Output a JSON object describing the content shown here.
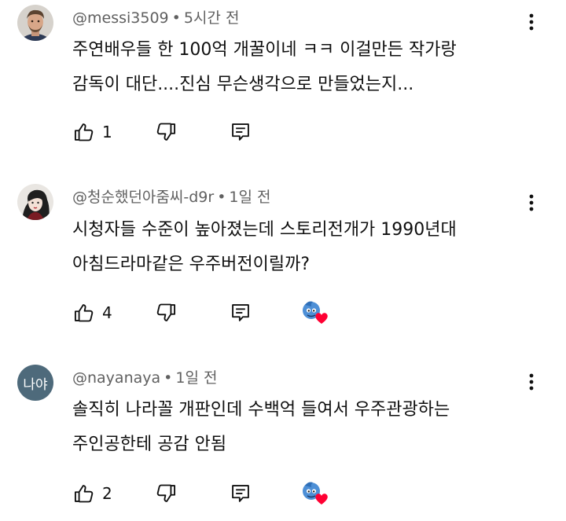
{
  "comments": [
    {
      "author": "@messi3509",
      "time": "5시간 전",
      "lines": [
        "주연배우들 한 100억 개꿀이네 ㅋㅋ 이걸만든 작가랑",
        "감독이 대단....진심 무슨생각으로 만들었는지..."
      ],
      "likes": "1",
      "avatar_icon": "profile-photo-icon",
      "creator_heart": false
    },
    {
      "author": "@청순했던아줌씨-d9r",
      "time": "1일 전",
      "lines": [
        "시청자들 수준이 높아졌는데  스토리전개가  1990년대",
        "아침드라마같은 우주버전이릴까?"
      ],
      "likes": "4",
      "avatar_icon": "profile-illustration-icon",
      "creator_heart": true
    },
    {
      "author": "@nayanaya",
      "time": "1일 전",
      "lines": [
        "솔직히 나라꼴 개판인데 수백억 들여서 우주관광하는",
        "주인공한테 공감 안됨"
      ],
      "likes": "2",
      "avatar_text": "나야",
      "creator_heart": true
    }
  ],
  "separator": "•",
  "icons": {
    "like": "thumbs-up-icon",
    "dislike": "thumbs-down-icon",
    "reply": "reply-icon",
    "more": "more-vert-icon",
    "heart": "creator-heart-icon"
  },
  "colors": {
    "meta_text": "#606060",
    "body_text": "#0f0f0f",
    "heart": "#ff0033",
    "avatar_letters_bg": "#4e6a7b"
  }
}
